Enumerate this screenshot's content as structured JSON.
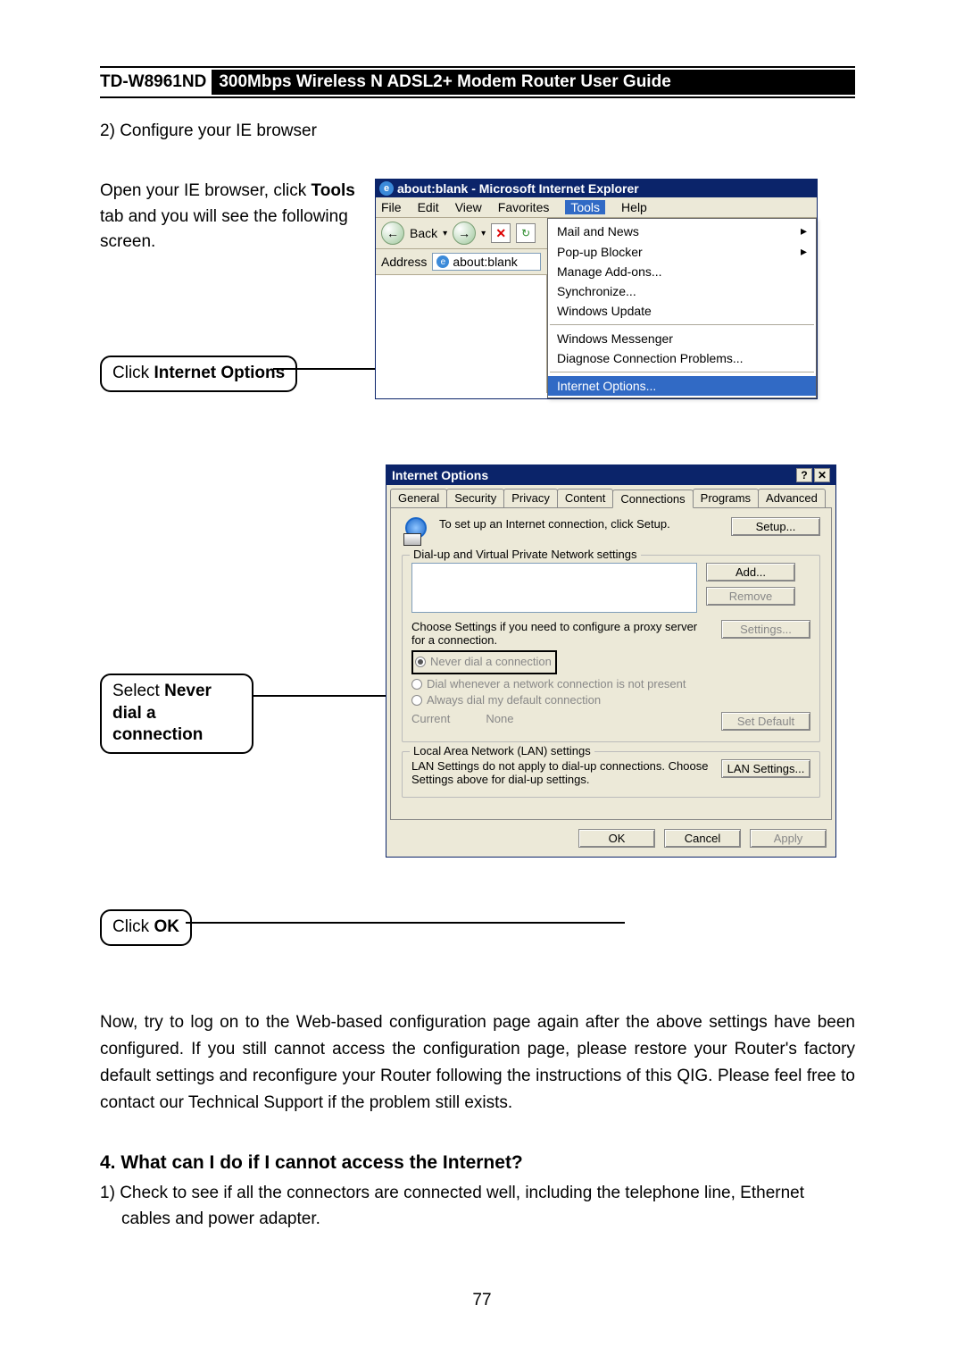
{
  "header": {
    "model": "TD-W8961ND",
    "title": "300Mbps Wireless N ADSL2+ Modem Router User Guide"
  },
  "step2_prefix": "2)  ",
  "step2_text": "Configure your IE browser",
  "intro_open": "Open your IE browser, click ",
  "intro_tools_bold": "Tools",
  "intro_rest": " tab and you will see the following screen.",
  "callout1_pre": "Click ",
  "callout1_bold": "Internet Options",
  "ie": {
    "title": "about:blank - Microsoft Internet Explorer",
    "menu": {
      "file": "File",
      "edit": "Edit",
      "view": "View",
      "favorites": "Favorites",
      "tools": "Tools",
      "help": "Help"
    },
    "back": "Back",
    "address_label": "Address",
    "address_value": "about:blank",
    "tools_menu": {
      "mail": "Mail and News",
      "popup": "Pop-up Blocker",
      "addons": "Manage Add-ons...",
      "sync": "Synchronize...",
      "update": "Windows Update",
      "messenger": "Windows Messenger",
      "diagnose": "Diagnose Connection Problems...",
      "internet_options": "Internet Options..."
    }
  },
  "callout2_pre": "Select ",
  "callout2_bold": "Never dial a connection",
  "io": {
    "title": "Internet Options",
    "tabs": {
      "general": "General",
      "security": "Security",
      "privacy": "Privacy",
      "content": "Content",
      "connections": "Connections",
      "programs": "Programs",
      "advanced": "Advanced"
    },
    "setup_text": "To set up an Internet connection, click Setup.",
    "btn_setup": "Setup...",
    "dialup_legend": "Dial-up and Virtual Private Network settings",
    "btn_add": "Add...",
    "btn_remove": "Remove",
    "choose_text": "Choose Settings if you need to configure a proxy server for a connection.",
    "btn_settings": "Settings...",
    "radio_never": "Never dial a connection",
    "radio_whenever": "Dial whenever a network connection is not present",
    "radio_always": "Always dial my default connection",
    "current_label": "Current",
    "current_value": "None",
    "btn_setdefault": "Set Default",
    "lan_legend": "Local Area Network (LAN) settings",
    "lan_text": "LAN Settings do not apply to dial-up connections. Choose Settings above for dial-up settings.",
    "btn_lan": "LAN Settings...",
    "btn_ok": "OK",
    "btn_cancel": "Cancel",
    "btn_apply": "Apply"
  },
  "callout3_pre": "Click ",
  "callout3_bold": "OK",
  "paragraph": "Now, try to log on to the Web-based configuration page again after the above settings have been configured. If you still cannot access the configuration page, please restore your Router's factory default settings and reconfigure your Router following the instructions of this QIG. Please feel free to contact our Technical Support if the problem still exists.",
  "q4_heading": "4.  What can I do if I cannot access the Internet?",
  "q4_prefix": "1) ",
  "q4_item1": "Check to see if all the connectors are connected well, including the telephone line, Ethernet cables and power adapter.",
  "page_no": "77"
}
